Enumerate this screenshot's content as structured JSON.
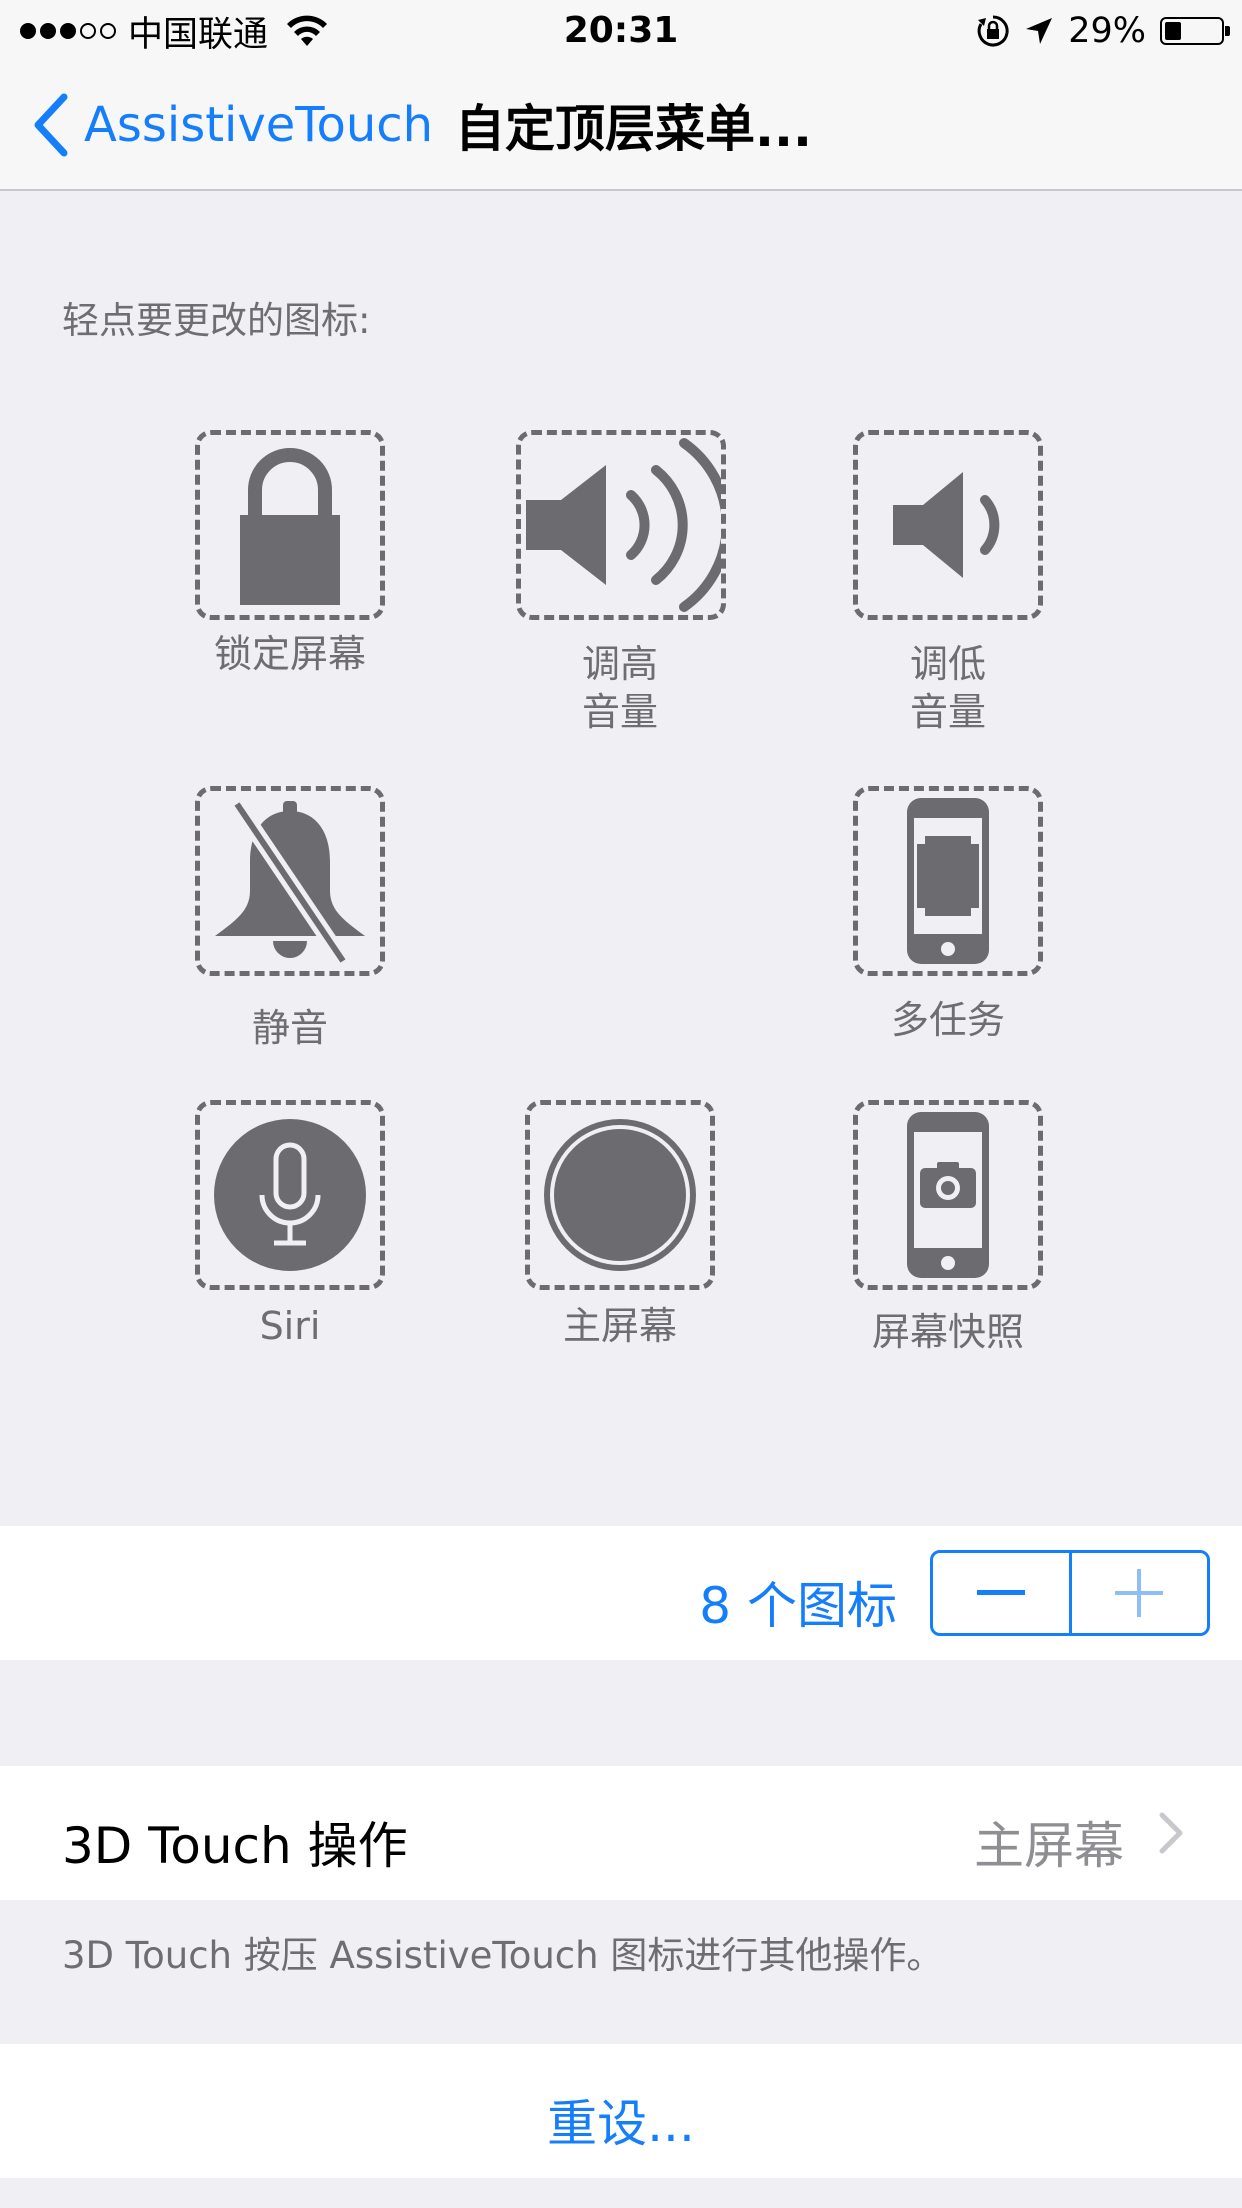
{
  "status_bar": {
    "signal_dots_filled": 3,
    "signal_dots_total": 5,
    "carrier": "中国联通",
    "wifi_icon": "wifi-icon",
    "time": "20:31",
    "rotation_lock_icon": "rotation-lock-icon",
    "location_icon": "location-arrow-icon",
    "battery_percent_text": "29%",
    "battery_level": 0.29
  },
  "nav": {
    "back_label": "AssistiveTouch",
    "title": "自定顶层菜单..."
  },
  "section": {
    "label": "轻点要更改的图标:"
  },
  "icons": [
    {
      "name": "lock-icon",
      "label": "锁定屏幕",
      "label_line2": ""
    },
    {
      "name": "volume-up-icon",
      "label": "调高",
      "label_line2": "音量"
    },
    {
      "name": "volume-down-icon",
      "label": "调低",
      "label_line2": "音量"
    },
    {
      "name": "mute-icon",
      "label": "静音",
      "label_line2": ""
    },
    {
      "name": "multitasking-icon",
      "label": "多任务",
      "label_line2": ""
    },
    {
      "name": "siri-icon",
      "label": "Siri",
      "label_line2": ""
    },
    {
      "name": "home-icon",
      "label": "主屏幕",
      "label_line2": ""
    },
    {
      "name": "screenshot-icon",
      "label": "屏幕快照",
      "label_line2": ""
    }
  ],
  "count": {
    "text": "8 个图标",
    "minus_label": "−",
    "plus_label": "+"
  },
  "touch3d": {
    "label": "3D Touch 操作",
    "value": "主屏幕",
    "footnote": "3D Touch 按压 AssistiveTouch 图标进行其他操作。"
  },
  "reset": {
    "label": "重设..."
  },
  "colors": {
    "accent": "#157efb",
    "background": "#efeff4",
    "icon_gray": "#6b6b70"
  }
}
